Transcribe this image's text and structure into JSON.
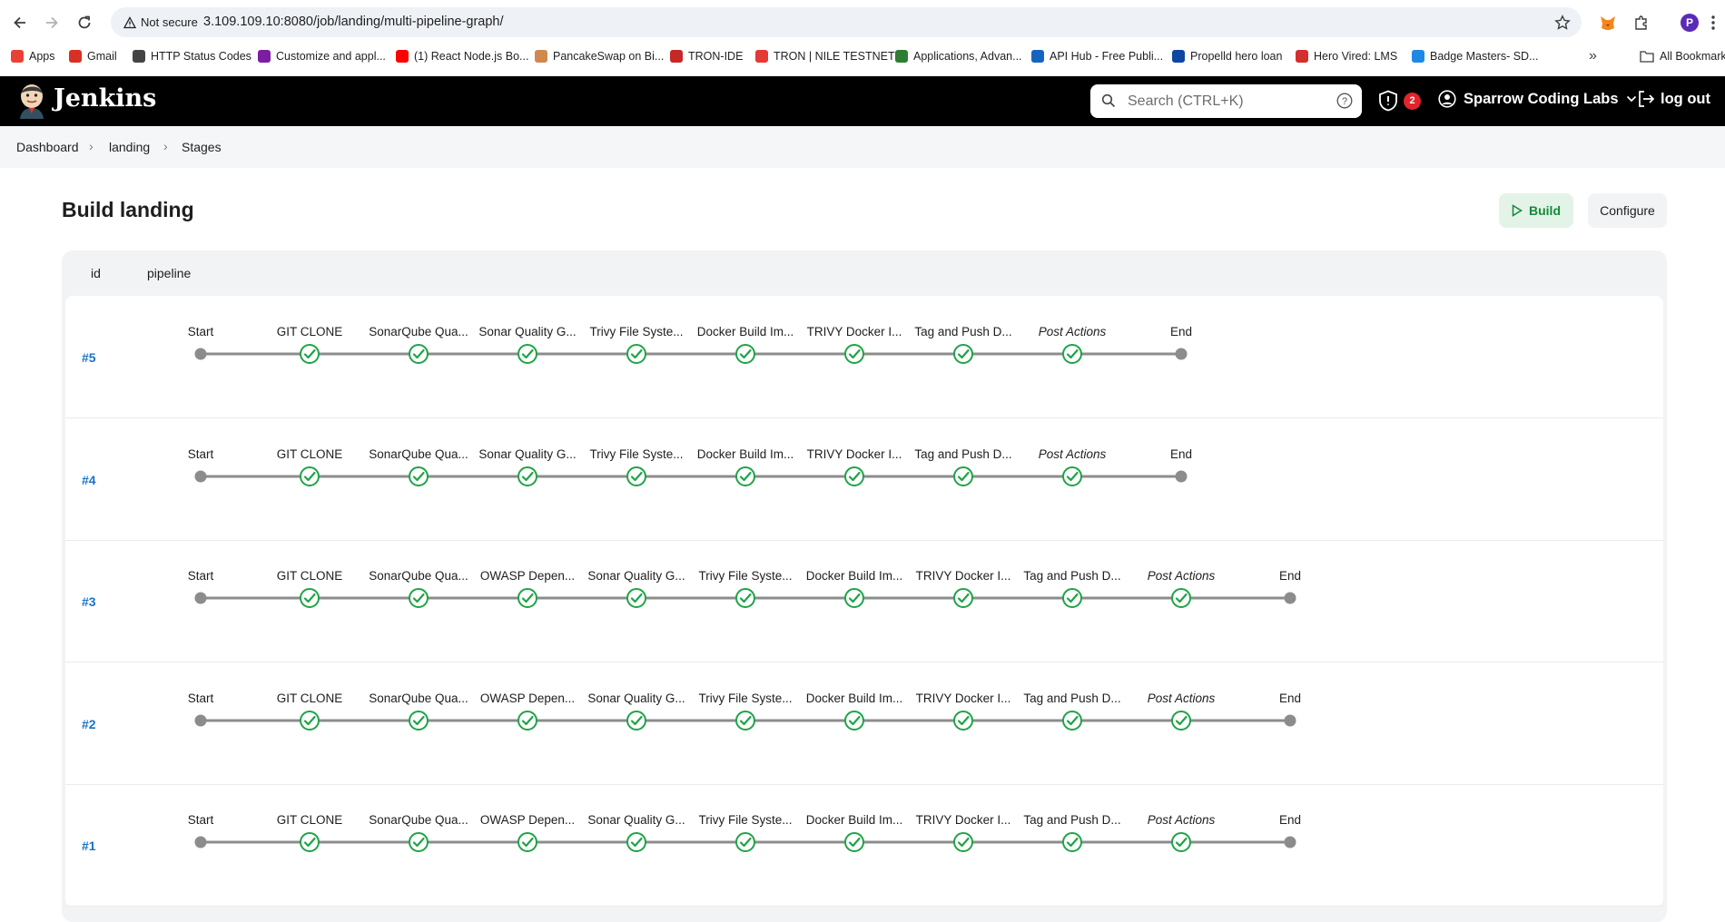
{
  "browser": {
    "not_secure": "Not secure",
    "url": "3.109.109.10:8080/job/landing/multi-pipeline-graph/",
    "profile_initial": "P",
    "bookmarks": [
      {
        "label": "Apps",
        "icon": "apps-grid-icon",
        "color": "#e94235"
      },
      {
        "label": "Gmail",
        "icon": "gmail-icon",
        "color": "#d93025"
      },
      {
        "label": "HTTP Status Codes",
        "icon": "globe-icon",
        "color": "#444444"
      },
      {
        "label": "Customize and appl...",
        "icon": "crown-icon",
        "color": "#7b1fa2"
      },
      {
        "label": "(1) React Node.js Bo...",
        "icon": "youtube-icon",
        "color": "#ff0000"
      },
      {
        "label": "PancakeSwap on Bi...",
        "icon": "pancake-icon",
        "color": "#d1884f"
      },
      {
        "label": "TRON-IDE",
        "icon": "tron-ide-icon",
        "color": "#c62828"
      },
      {
        "label": "TRON | NILE TESTNET",
        "icon": "tron-icon",
        "color": "#e53935"
      },
      {
        "label": "Applications, Advan...",
        "icon": "applications-icon",
        "color": "#2e7d32"
      },
      {
        "label": "API Hub - Free Publi...",
        "icon": "api-hub-icon",
        "color": "#1565c0"
      },
      {
        "label": "Propelld hero loan",
        "icon": "propelld-icon",
        "color": "#0d47a1"
      },
      {
        "label": "Hero Vired: LMS",
        "icon": "hero-vired-icon",
        "color": "#d32f2f"
      },
      {
        "label": "Badge Masters- SD...",
        "icon": "badge-icon",
        "color": "#1e88e5"
      }
    ],
    "all_bookmarks": "All Bookmarks"
  },
  "header": {
    "brand": "Jenkins",
    "search_placeholder": "Search (CTRL+K)",
    "security_count": "2",
    "user": "Sparrow Coding Labs",
    "logout": "log out"
  },
  "breadcrumb": [
    "Dashboard",
    "landing",
    "Stages"
  ],
  "page": {
    "title": "Build landing",
    "build_label": "Build",
    "configure_label": "Configure",
    "col_id": "id",
    "col_pipeline": "pipeline"
  },
  "runs": [
    {
      "id": "#5",
      "stages": [
        "Start",
        "GIT CLONE",
        "SonarQube Qua...",
        "Sonar Quality G...",
        "Trivy File Syste...",
        "Docker Build Im...",
        "TRIVY Docker I...",
        "Tag and Push D...",
        "Post Actions",
        "End"
      ]
    },
    {
      "id": "#4",
      "stages": [
        "Start",
        "GIT CLONE",
        "SonarQube Qua...",
        "Sonar Quality G...",
        "Trivy File Syste...",
        "Docker Build Im...",
        "TRIVY Docker I...",
        "Tag and Push D...",
        "Post Actions",
        "End"
      ]
    },
    {
      "id": "#3",
      "stages": [
        "Start",
        "GIT CLONE",
        "SonarQube Qua...",
        "OWASP Depen...",
        "Sonar Quality G...",
        "Trivy File Syste...",
        "Docker Build Im...",
        "TRIVY Docker I...",
        "Tag and Push D...",
        "Post Actions",
        "End"
      ]
    },
    {
      "id": "#2",
      "stages": [
        "Start",
        "GIT CLONE",
        "SonarQube Qua...",
        "OWASP Depen...",
        "Sonar Quality G...",
        "Trivy File Syste...",
        "Docker Build Im...",
        "TRIVY Docker I...",
        "Tag and Push D...",
        "Post Actions",
        "End"
      ]
    },
    {
      "id": "#1",
      "stages": [
        "Start",
        "GIT CLONE",
        "SonarQube Qua...",
        "OWASP Depen...",
        "Sonar Quality G...",
        "Trivy File Syste...",
        "Docker Build Im...",
        "TRIVY Docker I...",
        "Tag and Push D...",
        "Post Actions",
        "End"
      ]
    }
  ],
  "colors": {
    "success": "#1ea446",
    "node_grey": "#8c8c8c",
    "link": "#1a73c8"
  }
}
